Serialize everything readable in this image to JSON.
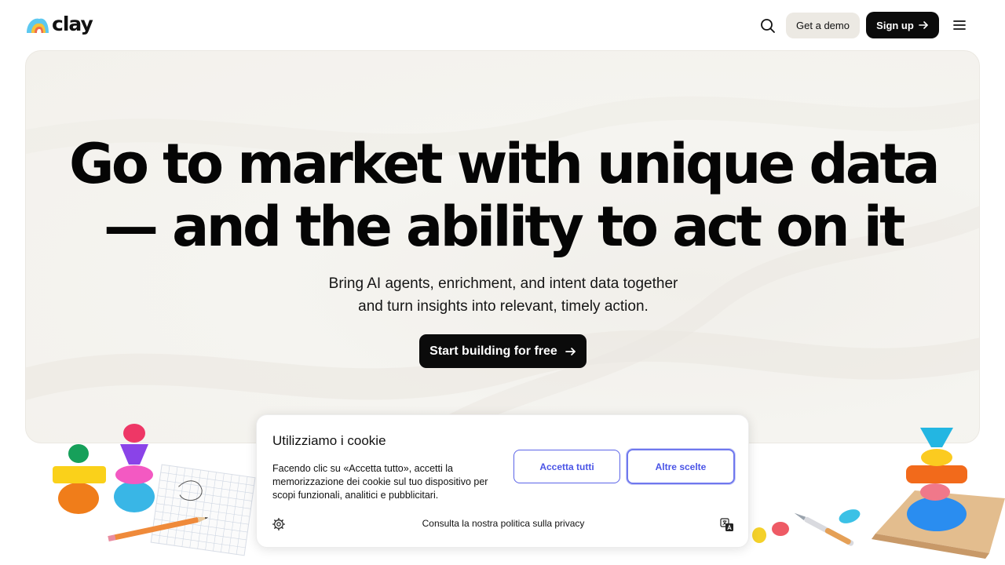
{
  "nav": {
    "logo_text": "clay",
    "demo_label": "Get a demo",
    "signup_label": "Sign up",
    "icons": [
      "search-icon",
      "arrow-right-icon",
      "hamburger-menu-icon"
    ]
  },
  "hero": {
    "headline_line1": "Go to market with unique data",
    "headline_line2": "— and the ability to act on it",
    "sub_line1": "Bring AI agents, enrichment, and intent data together",
    "sub_line2": "and turn insights into relevant, timely action.",
    "cta_label": "Start building for free"
  },
  "cookie": {
    "title": "Utilizziamo i cookie",
    "body": "Facendo clic su «Accetta tutto», accetti la memorizzazione dei cookie sul tuo dispositivo per scopi funzionali, analitici e pubblicitari.",
    "accept_label": "Accetta tutti",
    "more_label": "Altre scelte",
    "policy_label": "Consulta la nostra politica sulla privacy"
  },
  "colors": {
    "brand_black": "#0b0b0b",
    "hero_bg": "#f4f3ef",
    "cookie_accent": "#4a54e6",
    "demo_bg": "#ece9e3"
  }
}
